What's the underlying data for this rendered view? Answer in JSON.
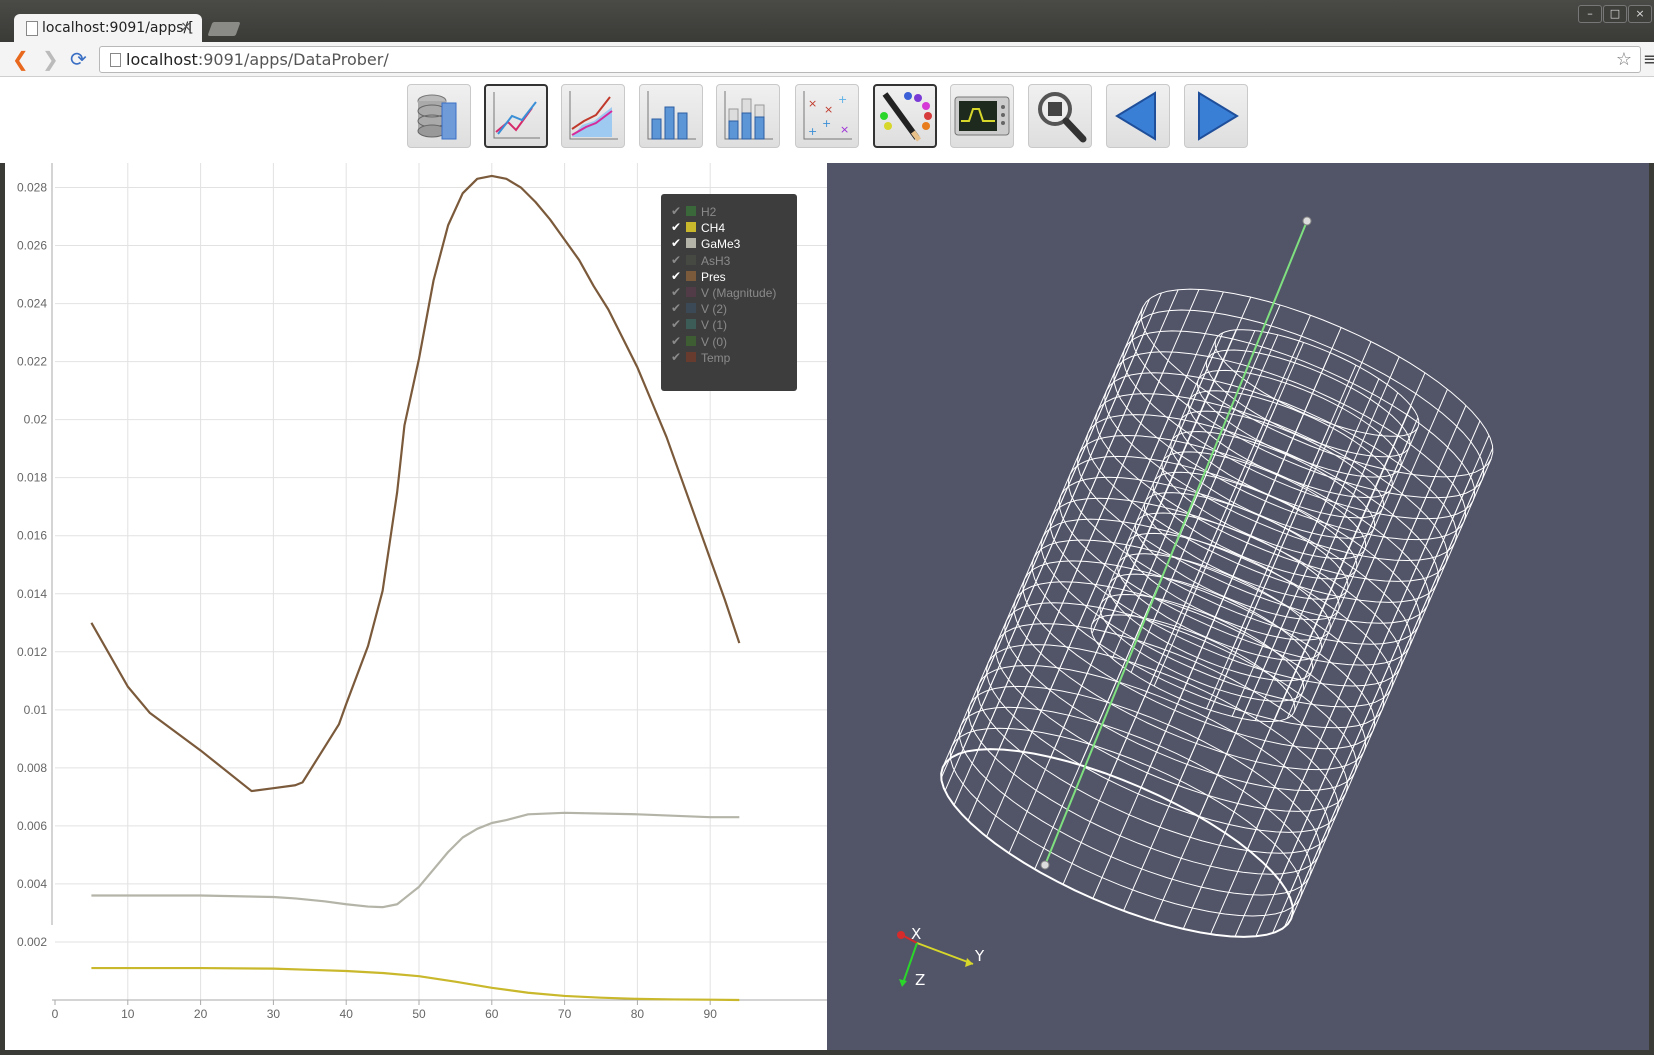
{
  "browser": {
    "tab_title": "localhost:9091/apps/[",
    "close_glyph": "×",
    "url_host": "localhost",
    "url_rest": ":9091/apps/DataProber/",
    "back_glyph": "❮",
    "forward_glyph": "❯",
    "reload_glyph": "⟳",
    "star_glyph": "☆",
    "menu_glyph": "≡",
    "win_minimize": "–",
    "win_maximize": "□",
    "win_close": "×"
  },
  "toolbar": {
    "buttons": [
      {
        "name": "data-source-icon",
        "active": false
      },
      {
        "name": "line-chart-icon",
        "active": true
      },
      {
        "name": "area-chart-icon",
        "active": false
      },
      {
        "name": "bar-chart-icon",
        "active": false
      },
      {
        "name": "stacked-bar-chart-icon",
        "active": false
      },
      {
        "name": "scatter-plot-icon",
        "active": false
      },
      {
        "name": "color-palette-icon",
        "active": true
      },
      {
        "name": "oscilloscope-icon",
        "active": false
      },
      {
        "name": "zoom-icon",
        "active": false
      },
      {
        "name": "previous-icon",
        "active": false
      },
      {
        "name": "next-icon",
        "active": false
      }
    ]
  },
  "legend": {
    "items": [
      {
        "label": "H2",
        "checked": false,
        "color": "#3b7a3b"
      },
      {
        "label": "CH4",
        "checked": true,
        "color": "#c9b82b"
      },
      {
        "label": "GaMe3",
        "checked": true,
        "color": "#b4b4a8"
      },
      {
        "label": "AsH3",
        "checked": false,
        "color": "#4a4d44"
      },
      {
        "label": "Pres",
        "checked": true,
        "color": "#7b5a3b"
      },
      {
        "label": "V (Magnitude)",
        "checked": false,
        "color": "#5a3a4a"
      },
      {
        "label": "V (2)",
        "checked": false,
        "color": "#3a4f63"
      },
      {
        "label": "V (1)",
        "checked": false,
        "color": "#3b6a63"
      },
      {
        "label": "V (0)",
        "checked": false,
        "color": "#3f6b2f"
      },
      {
        "label": "Temp",
        "checked": false,
        "color": "#7a3a2a"
      }
    ],
    "check_glyph": "✔"
  },
  "axes_labels": {
    "x_axis": "X",
    "y_axis": "Y",
    "z_axis": "Z"
  },
  "chart_data": {
    "type": "line",
    "xlim": [
      0,
      100
    ],
    "ylim": [
      0,
      0.0285
    ],
    "x_ticks": [
      0,
      10,
      20,
      30,
      40,
      50,
      60,
      70,
      80,
      90
    ],
    "y_ticks": [
      0.002,
      0.004,
      0.006,
      0.008,
      0.01,
      0.012,
      0.014,
      0.016,
      0.018,
      0.02,
      0.022,
      0.024,
      0.026,
      0.028
    ],
    "y_tick_labels": [
      "0.002",
      "0.004",
      "0.006",
      "0.008",
      "0.01",
      "0.012",
      "0.014",
      "0.016",
      "0.018",
      "0.02",
      "0.022",
      "0.024",
      "0.026",
      "0.028"
    ],
    "grid": true,
    "series": [
      {
        "name": "Pres",
        "color": "#7b5a3b",
        "x": [
          5,
          10,
          13,
          20,
          27,
          30,
          33,
          34,
          37,
          39,
          40,
          43,
          45,
          47,
          48,
          50,
          52,
          54,
          56,
          58,
          60,
          62,
          64,
          66,
          68,
          70,
          72,
          74,
          76,
          78,
          80,
          82,
          84,
          86,
          88,
          90,
          92,
          94
        ],
        "y": [
          0.013,
          0.0108,
          0.0099,
          0.0086,
          0.0072,
          0.0073,
          0.0074,
          0.0075,
          0.0087,
          0.0095,
          0.0102,
          0.0122,
          0.0141,
          0.0175,
          0.0198,
          0.0221,
          0.0248,
          0.0267,
          0.0278,
          0.0283,
          0.0284,
          0.0283,
          0.028,
          0.0275,
          0.0269,
          0.0262,
          0.0255,
          0.0246,
          0.0238,
          0.0228,
          0.0218,
          0.0206,
          0.0194,
          0.018,
          0.0166,
          0.0152,
          0.0138,
          0.0123
        ]
      },
      {
        "name": "GaMe3",
        "color": "#b4b4a8",
        "x": [
          5,
          10,
          20,
          30,
          33,
          37,
          40,
          43,
          45,
          47,
          48,
          50,
          52,
          54,
          56,
          58,
          60,
          62,
          65,
          70,
          80,
          90,
          94
        ],
        "y": [
          0.0036,
          0.0036,
          0.0036,
          0.00355,
          0.0035,
          0.0034,
          0.0033,
          0.00322,
          0.0032,
          0.0033,
          0.0035,
          0.0039,
          0.0045,
          0.0051,
          0.0056,
          0.0059,
          0.0061,
          0.0062,
          0.0064,
          0.00645,
          0.0064,
          0.0063,
          0.0063
        ]
      },
      {
        "name": "CH4",
        "color": "#c9b82b",
        "x": [
          5,
          10,
          20,
          30,
          35,
          40,
          45,
          50,
          55,
          60,
          65,
          70,
          75,
          80,
          85,
          90,
          94
        ],
        "y": [
          0.0011,
          0.0011,
          0.0011,
          0.00108,
          0.00104,
          0.001,
          0.00093,
          0.00082,
          0.00063,
          0.00042,
          0.00025,
          0.00014,
          8e-05,
          4e-05,
          2e-05,
          1e-05,
          0.0
        ]
      }
    ]
  }
}
